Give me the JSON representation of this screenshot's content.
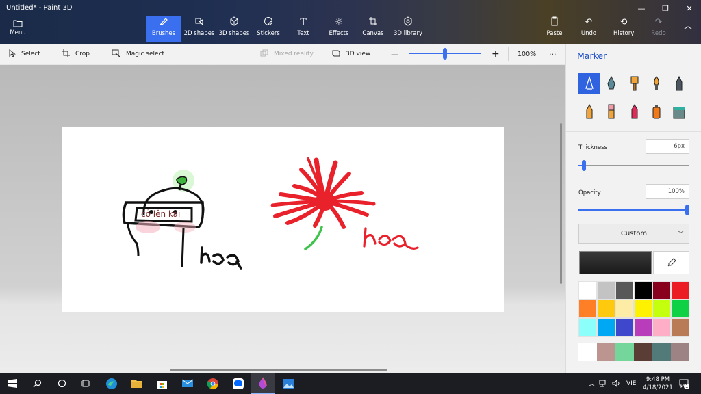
{
  "window": {
    "title": "Untitled* - Paint 3D",
    "min": "—",
    "max": "❐",
    "close": "✕"
  },
  "menu": {
    "label": "Menu"
  },
  "ribbon": [
    {
      "id": "brushes",
      "label": "Brushes",
      "icon": "brush-icon",
      "active": true
    },
    {
      "id": "2d-shapes",
      "label": "2D shapes",
      "icon": "shapes-2d-icon"
    },
    {
      "id": "3d-shapes",
      "label": "3D shapes",
      "icon": "cube-icon"
    },
    {
      "id": "stickers",
      "label": "Stickers",
      "icon": "sticker-icon"
    },
    {
      "id": "text",
      "label": "Text",
      "icon": "text-icon"
    },
    {
      "id": "effects",
      "label": "Effects",
      "icon": "effects-icon"
    },
    {
      "id": "canvas",
      "label": "Canvas",
      "icon": "canvas-icon"
    },
    {
      "id": "3d-library",
      "label": "3D library",
      "icon": "library-icon"
    }
  ],
  "ribbon_right": {
    "paste": "Paste",
    "undo": "Undo",
    "history": "History",
    "redo": "Redo"
  },
  "toolbar": {
    "select": "Select",
    "crop": "Crop",
    "magic_select": "Magic select",
    "mixed_reality": "Mixed reality",
    "view_3d": "3D view",
    "zoom_out": "—",
    "zoom_in": "+",
    "zoom_value": "100%",
    "more": "···",
    "zoom_level": 0.5
  },
  "canvas_text": {
    "annotation": "cỏ lên kai"
  },
  "panel": {
    "title": "Marker",
    "thickness_label": "Thickness",
    "thickness_value": "6px",
    "thickness_level": 0.05,
    "opacity_label": "Opacity",
    "opacity_value": "100%",
    "opacity_level": 1.0,
    "color_mode": "Custom",
    "current_color": "#1a1a1a",
    "accent": "#3a6ff0",
    "palette": [
      "#ffffff",
      "#c3c3c3",
      "#585858",
      "#000000",
      "#88001b",
      "#ec1c24",
      "#ff7f27",
      "#ffc90e",
      "#fdeca6",
      "#fff200",
      "#c4ff0e",
      "#0ed145",
      "#8cfffb",
      "#00a8f3",
      "#3f48cc",
      "#b83dba",
      "#ffaec8",
      "#b97a56"
    ],
    "custom_palette": [
      "#ffffff",
      "#bc9490",
      "#74d69a",
      "#5a3e36",
      "#517a78",
      "#9e8384"
    ]
  },
  "taskbar": {
    "lang": "VIE",
    "time": "9:48 PM",
    "date": "4/18/2021",
    "notifications": "1"
  }
}
